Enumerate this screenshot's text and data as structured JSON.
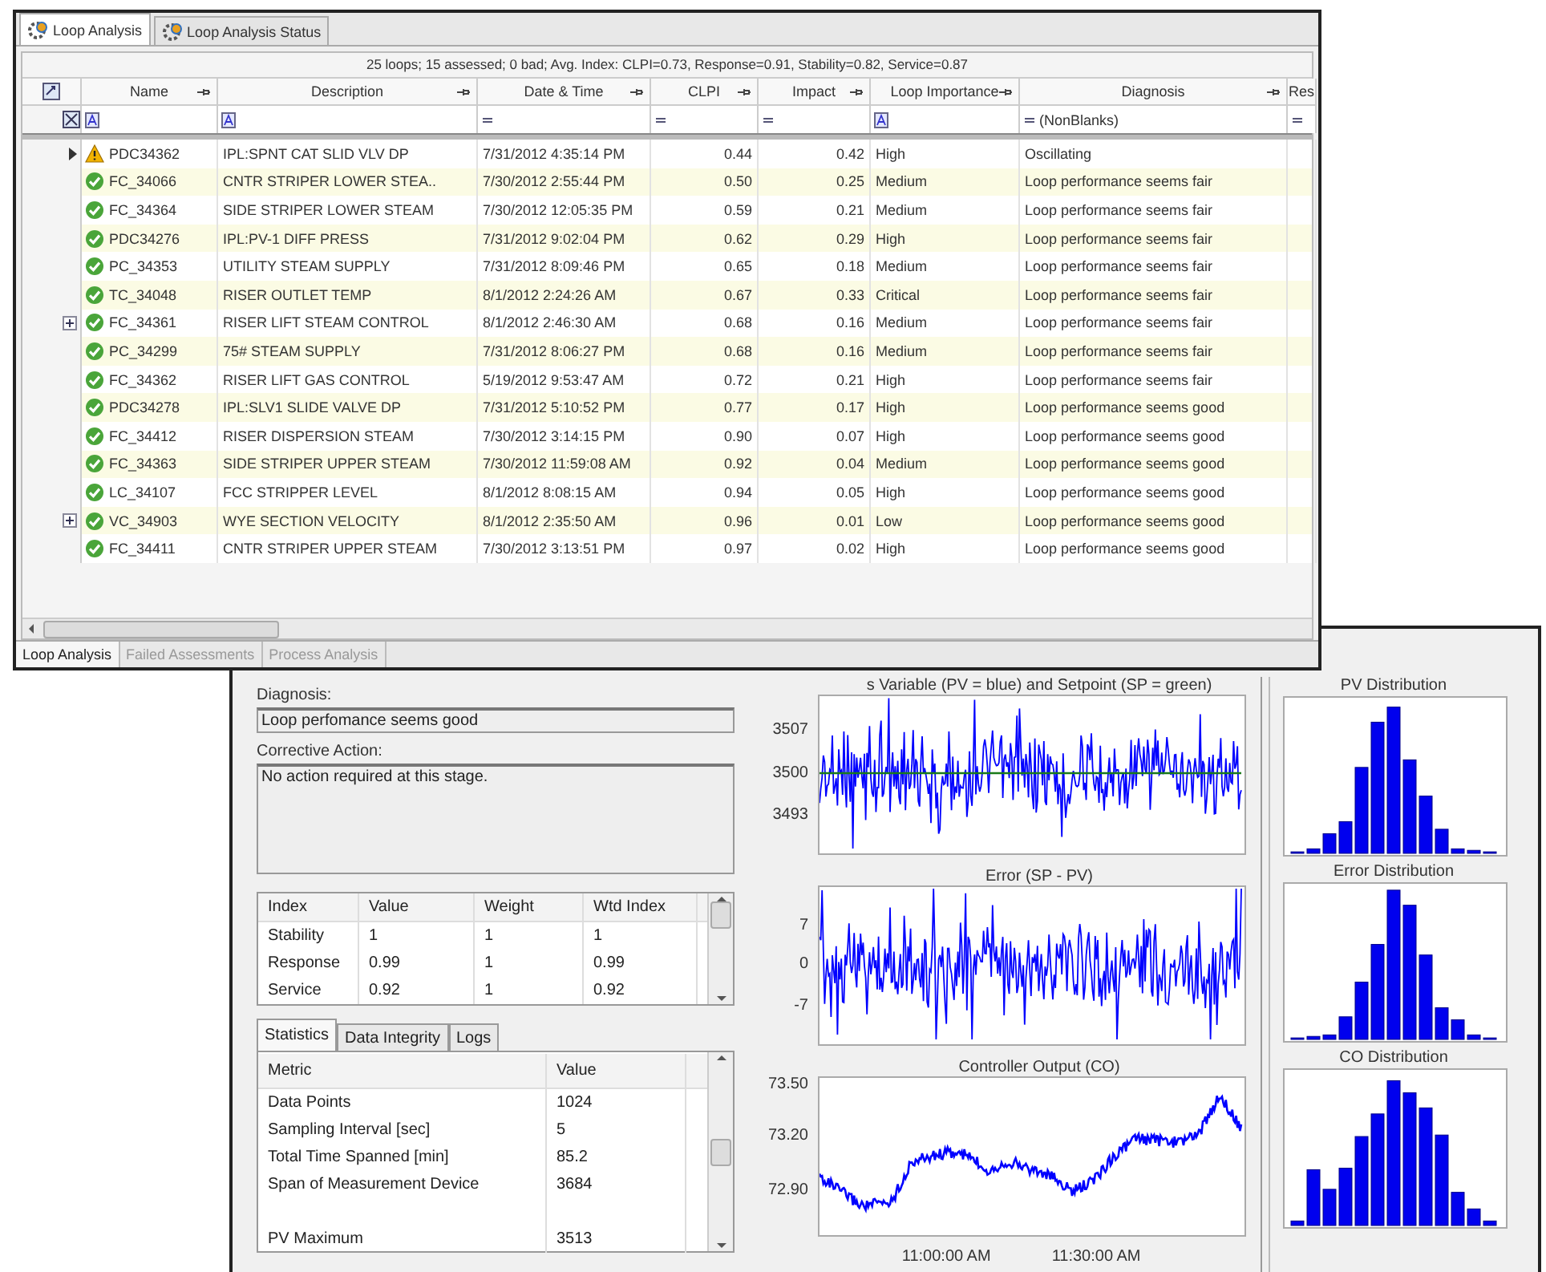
{
  "loop_window": {
    "tabs": [
      {
        "label": "Loop Analysis",
        "selected": true
      },
      {
        "label": "Loop Analysis Status",
        "selected": false
      }
    ],
    "summary": "25 loops; 15 assessed; 0 bad; Avg. Index: CLPI=0.73, Response=0.91, Stability=0.82, Service=0.87",
    "columns": [
      {
        "label": "Name",
        "filter": {
          "kind": "text"
        }
      },
      {
        "label": "Description",
        "filter": {
          "kind": "text"
        }
      },
      {
        "label": "Date & Time",
        "filter": {
          "kind": "equals"
        }
      },
      {
        "label": "CLPI",
        "filter": {
          "kind": "equals"
        }
      },
      {
        "label": "Impact",
        "filter": {
          "kind": "equals"
        }
      },
      {
        "label": "Loop Importance",
        "filter": {
          "kind": "text"
        }
      },
      {
        "label": "Diagnosis",
        "filter": {
          "kind": "equals",
          "value": "(NonBlanks)"
        }
      },
      {
        "label": "Res",
        "filter": {
          "kind": "equals"
        }
      }
    ],
    "rows": [
      {
        "kind": "warning",
        "current": true,
        "expandable": false,
        "name": "PDC34362",
        "description": "IPL:SPNT CAT SLID VLV DP",
        "date_time": "7/31/2012 4:35:14 PM",
        "clpi": "0.44",
        "impact": "0.42",
        "importance": "High",
        "diagnosis": "Oscillating"
      },
      {
        "kind": "ok",
        "current": false,
        "expandable": false,
        "name": "FC_34066",
        "description": "CNTR  STRIPER LOWER  STEA..",
        "date_time": "7/30/2012 2:55:44 PM",
        "clpi": "0.50",
        "impact": "0.25",
        "importance": "Medium",
        "diagnosis": "Loop performance seems fair"
      },
      {
        "kind": "ok",
        "current": false,
        "expandable": false,
        "name": "FC_34364",
        "description": "SIDE STRIPER LOWER STEAM",
        "date_time": "7/30/2012 12:05:35 PM",
        "clpi": "0.59",
        "impact": "0.21",
        "importance": "Medium",
        "diagnosis": "Loop performance seems fair"
      },
      {
        "kind": "ok",
        "current": false,
        "expandable": false,
        "name": "PDC34276",
        "description": "IPL:PV-1 DIFF PRESS",
        "date_time": "7/31/2012 9:02:04 PM",
        "clpi": "0.62",
        "impact": "0.29",
        "importance": "High",
        "diagnosis": "Loop performance seems fair"
      },
      {
        "kind": "ok",
        "current": false,
        "expandable": false,
        "name": "PC_34353",
        "description": "UTILITY STEAM SUPPLY",
        "date_time": "7/31/2012 8:09:46 PM",
        "clpi": "0.65",
        "impact": "0.18",
        "importance": "Medium",
        "diagnosis": "Loop performance seems fair"
      },
      {
        "kind": "ok",
        "current": false,
        "expandable": false,
        "name": "TC_34048",
        "description": "RISER OUTLET TEMP",
        "date_time": "8/1/2012 2:24:26 AM",
        "clpi": "0.67",
        "impact": "0.33",
        "importance": "Critical",
        "diagnosis": "Loop performance seems fair"
      },
      {
        "kind": "ok",
        "current": false,
        "expandable": true,
        "name": "FC_34361",
        "description": "RISER LIFT STEAM CONTROL",
        "date_time": "8/1/2012 2:46:30 AM",
        "clpi": "0.68",
        "impact": "0.16",
        "importance": "Medium",
        "diagnosis": "Loop performance seems fair"
      },
      {
        "kind": "ok",
        "current": false,
        "expandable": false,
        "name": "PC_34299",
        "description": "75# STEAM SUPPLY",
        "date_time": "7/31/2012 8:06:27 PM",
        "clpi": "0.68",
        "impact": "0.16",
        "importance": "Medium",
        "diagnosis": "Loop performance seems fair"
      },
      {
        "kind": "ok",
        "current": false,
        "expandable": false,
        "name": "FC_34362",
        "description": "RISER LIFT GAS CONTROL",
        "date_time": "5/19/2012 9:53:47 AM",
        "clpi": "0.72",
        "impact": "0.21",
        "importance": "High",
        "diagnosis": "Loop performance seems fair"
      },
      {
        "kind": "ok",
        "current": false,
        "expandable": false,
        "name": "PDC34278",
        "description": "IPL:SLV1 SLIDE VALVE DP",
        "date_time": "7/31/2012 5:10:52 PM",
        "clpi": "0.77",
        "impact": "0.17",
        "importance": "High",
        "diagnosis": "Loop performance seems good"
      },
      {
        "kind": "ok",
        "current": false,
        "expandable": false,
        "name": "FC_34412",
        "description": "RISER DISPERSION STEAM",
        "date_time": "7/30/2012 3:14:15 PM",
        "clpi": "0.90",
        "impact": "0.07",
        "importance": "High",
        "diagnosis": "Loop performance seems good"
      },
      {
        "kind": "ok",
        "current": false,
        "expandable": false,
        "name": "FC_34363",
        "description": "SIDE STRIPER UPPER STEAM",
        "date_time": "7/30/2012 11:59:08 AM",
        "clpi": "0.92",
        "impact": "0.04",
        "importance": "Medium",
        "diagnosis": "Loop performance seems good"
      },
      {
        "kind": "ok",
        "current": false,
        "expandable": false,
        "name": "LC_34107",
        "description": "FCC STRIPPER LEVEL",
        "date_time": "8/1/2012 8:08:15 AM",
        "clpi": "0.94",
        "impact": "0.05",
        "importance": "High",
        "diagnosis": "Loop performance seems good"
      },
      {
        "kind": "ok",
        "current": false,
        "expandable": true,
        "name": "VC_34903",
        "description": "WYE SECTION VELOCITY",
        "date_time": "8/1/2012 2:35:50 AM",
        "clpi": "0.96",
        "impact": "0.01",
        "importance": "Low",
        "diagnosis": "Loop performance seems good"
      },
      {
        "kind": "ok",
        "current": false,
        "expandable": false,
        "name": "FC_34411",
        "description": "CNTR STRIPER UPPER STEAM",
        "date_time": "7/30/2012 3:13:51 PM",
        "clpi": "0.97",
        "impact": "0.02",
        "importance": "High",
        "diagnosis": "Loop performance seems good"
      }
    ],
    "bottom_tabs": [
      {
        "label": "Loop Analysis",
        "selected": true
      },
      {
        "label": "Failed Assessments",
        "selected": false
      },
      {
        "label": "Process Analysis",
        "selected": false
      }
    ]
  },
  "detail_window": {
    "diagnosis_label": "Diagnosis:",
    "diagnosis": "Loop perfomance seems good",
    "corrective_label": "Corrective Action:",
    "corrective_action": "No action required at this stage.",
    "index_table": {
      "columns": [
        "Index",
        "Value",
        "Weight",
        "Wtd Index"
      ],
      "rows": [
        [
          "Stability",
          "1",
          "1",
          "1"
        ],
        [
          "Response",
          "0.99",
          "1",
          "0.99"
        ],
        [
          "Service",
          "0.92",
          "1",
          "0.92"
        ]
      ]
    },
    "stat_tabs": [
      {
        "label": "Statistics",
        "selected": true
      },
      {
        "label": "Data Integrity",
        "selected": false
      },
      {
        "label": "Logs",
        "selected": false
      }
    ],
    "stats_table": {
      "columns": [
        "Metric",
        "Value"
      ],
      "rows": [
        {
          "kind": "metric",
          "metric": "Data Points",
          "value": "1024"
        },
        {
          "kind": "metric",
          "metric": "Sampling Interval [sec]",
          "value": "5"
        },
        {
          "kind": "metric",
          "metric": "Total Time Spanned [min]",
          "value": "85.2"
        },
        {
          "kind": "metric",
          "metric": "Span of Measurement Device",
          "value": "3684"
        },
        {
          "kind": "spacer"
        },
        {
          "kind": "metric",
          "metric": "PV Maximum",
          "value": "3513"
        }
      ]
    },
    "trend_charts": [
      {
        "kind": "pv_sp",
        "title": "s Variable (PV = blue) and Setpoint (SP = green)",
        "y_ticks": [
          "3507",
          "3500",
          "3493"
        ]
      },
      {
        "kind": "error",
        "title": "Error (SP - PV)",
        "y_ticks": [
          "7",
          "0",
          "-7"
        ]
      },
      {
        "kind": "co",
        "title": "Controller Output (CO)",
        "y_ticks": [
          "73.50",
          "73.20",
          "72.90"
        ],
        "x_ticks": [
          "11:00:00 AM",
          "11:30:00 AM"
        ]
      }
    ],
    "distributions": [
      {
        "kind": "pv",
        "title": "PV Distribution"
      },
      {
        "kind": "error",
        "title": "Error Distribution"
      },
      {
        "kind": "co",
        "title": "CO Distribution"
      }
    ]
  }
}
